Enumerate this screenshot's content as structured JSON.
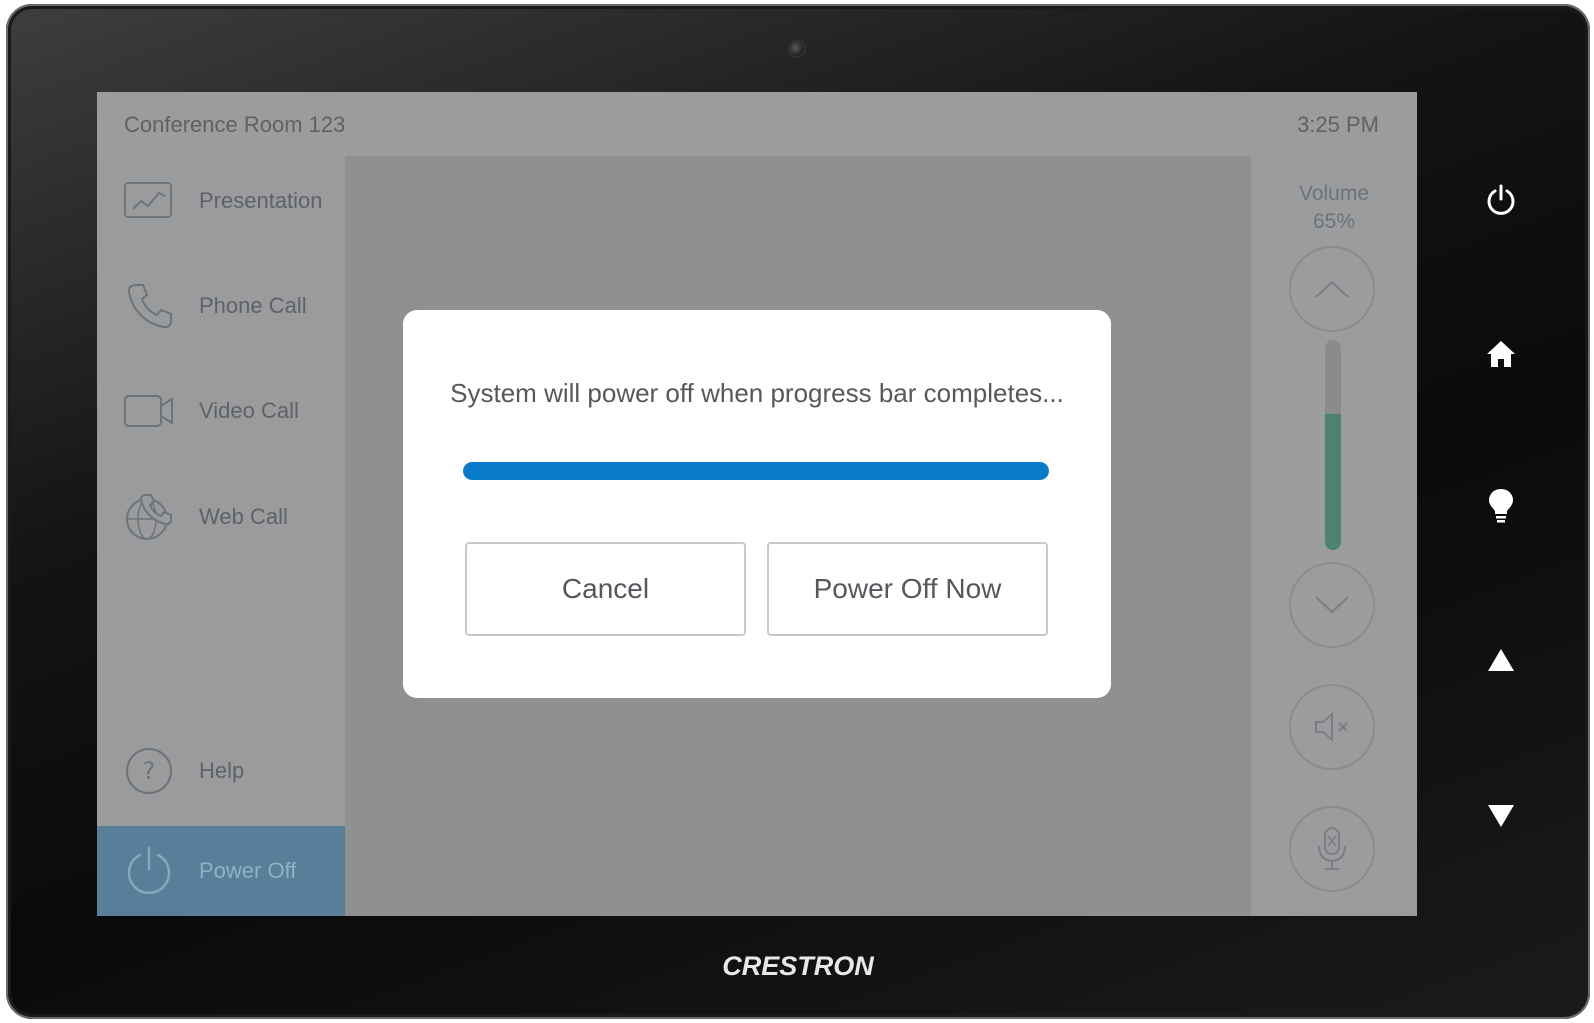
{
  "device": {
    "brand": "CRESTRON",
    "hardware_buttons": [
      {
        "name": "power",
        "icon": "power-icon"
      },
      {
        "name": "home",
        "icon": "home-icon"
      },
      {
        "name": "lights",
        "icon": "lightbulb-icon"
      },
      {
        "name": "up",
        "icon": "triangle-up-icon"
      },
      {
        "name": "down",
        "icon": "triangle-down-icon"
      }
    ]
  },
  "header": {
    "room_name": "Conference Room 123",
    "time": "3:25 PM"
  },
  "sidebar": {
    "items": [
      {
        "label": "Presentation",
        "icon": "presentation-chart-icon"
      },
      {
        "label": "Phone Call",
        "icon": "phone-icon"
      },
      {
        "label": "Video Call",
        "icon": "video-camera-icon"
      },
      {
        "label": "Web Call",
        "icon": "globe-phone-icon"
      },
      {
        "label": "Help",
        "icon": "help-icon"
      },
      {
        "label": "Power Off",
        "icon": "power-icon",
        "active": true
      }
    ]
  },
  "volume": {
    "label": "Volume",
    "value_text": "65%",
    "level": 0.65,
    "fill_color": "#4c8271",
    "up_icon": "chevron-up-icon",
    "down_icon": "chevron-down-icon",
    "mute_icon": "speaker-mute-icon",
    "mic_icon": "mic-mute-icon"
  },
  "dialog": {
    "message": "System will power off when progress bar completes...",
    "progress": 1.0,
    "progress_color": "#0a7acb",
    "cancel_label": "Cancel",
    "confirm_label": "Power Off Now"
  }
}
